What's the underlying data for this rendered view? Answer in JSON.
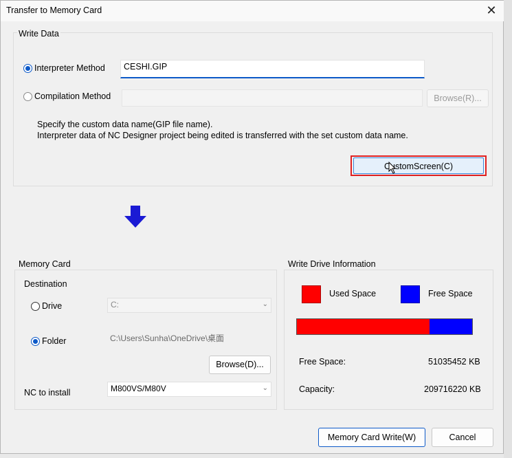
{
  "window": {
    "title": "Transfer to Memory Card",
    "close_glyph": "✕"
  },
  "write_data": {
    "group_label": "Write Data",
    "interpreter_label": "Interpreter Method",
    "interpreter_value": "CESHI.GIP",
    "compilation_label": "Compilation Method",
    "compilation_value": "",
    "browse_label": "Browse(R)...",
    "note_line1": "Specify the custom data name(GIP file name).",
    "note_line2": "Interpreter data of NC Designer project being edited is transferred with the set custom data name.",
    "custom_screen_label": "CustomScreen(C)"
  },
  "memory_card": {
    "group_label": "Memory Card",
    "destination_label": "Destination",
    "drive_label": "Drive",
    "drive_value": "C:",
    "folder_label": "Folder",
    "folder_value": "C:\\Users\\Sunha\\OneDrive\\桌面",
    "browse_label": "Browse(D)...",
    "nc_label": "NC to install",
    "nc_value": "M800VS/M80V"
  },
  "drive_info": {
    "group_label": "Write Drive Information",
    "used_label": "Used Space",
    "free_label": "Free Space",
    "used_color": "#ff0000",
    "free_color": "#0000ff",
    "used_fraction": 0.757,
    "free_space_label": "Free Space:",
    "free_space_value": "51035452 KB",
    "capacity_label": "Capacity:",
    "capacity_value": "209716220 KB"
  },
  "footer": {
    "write_label": "Memory Card Write(W)",
    "cancel_label": "Cancel"
  },
  "icons": {
    "arrow": "down-arrow-icon",
    "cursor": "mouse-cursor-icon"
  }
}
